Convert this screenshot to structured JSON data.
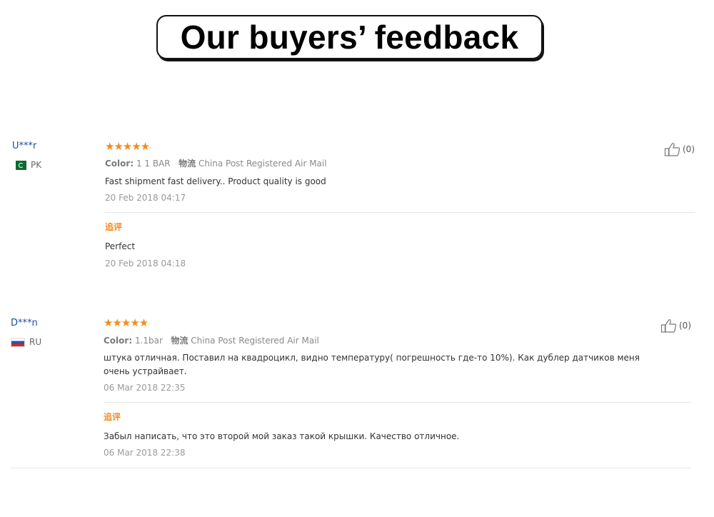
{
  "header": {
    "title": "Our buyers’ feedback"
  },
  "reviews": [
    {
      "user": "U***r",
      "country": "PK",
      "stars": "★★★★★",
      "rating": 5,
      "color_label": "Color:",
      "color_value": "1 1 BAR",
      "shipping_label": "物流",
      "shipping_value": "China Post Registered Air Mail",
      "text_lines": [
        "Fast shipment fast delivery.. Product quality is good"
      ],
      "date": "20 Feb 2018 04:17",
      "followup_label": "追评",
      "followup_text": "Perfect",
      "followup_date": "20 Feb 2018 04:18",
      "likes": "(0)"
    },
    {
      "user": "D***n",
      "country": "RU",
      "stars": "★★★★★",
      "rating": 5,
      "color_label": "Color:",
      "color_value": "1.1bar",
      "shipping_label": "物流",
      "shipping_value": "China Post Registered Air Mail",
      "text_lines": [
        "штука отличная. Поставил на квадроцикл, видно температуру( погрешность где-то 10%). Как дублер датчиков меня",
        "очень устрайвает."
      ],
      "date": "06 Mar 2018 22:35",
      "followup_label": "追评",
      "followup_text": "Забыл написать, что это второй мой заказ такой крышки. Качество отличное.",
      "followup_date": "06 Mar 2018 22:38",
      "likes": "(0)"
    }
  ],
  "icons": {
    "like": "thumbs-up-icon"
  },
  "colors": {
    "username": "#1b4fa3",
    "stars": "#f28c1b",
    "followup": "#f08c20"
  }
}
